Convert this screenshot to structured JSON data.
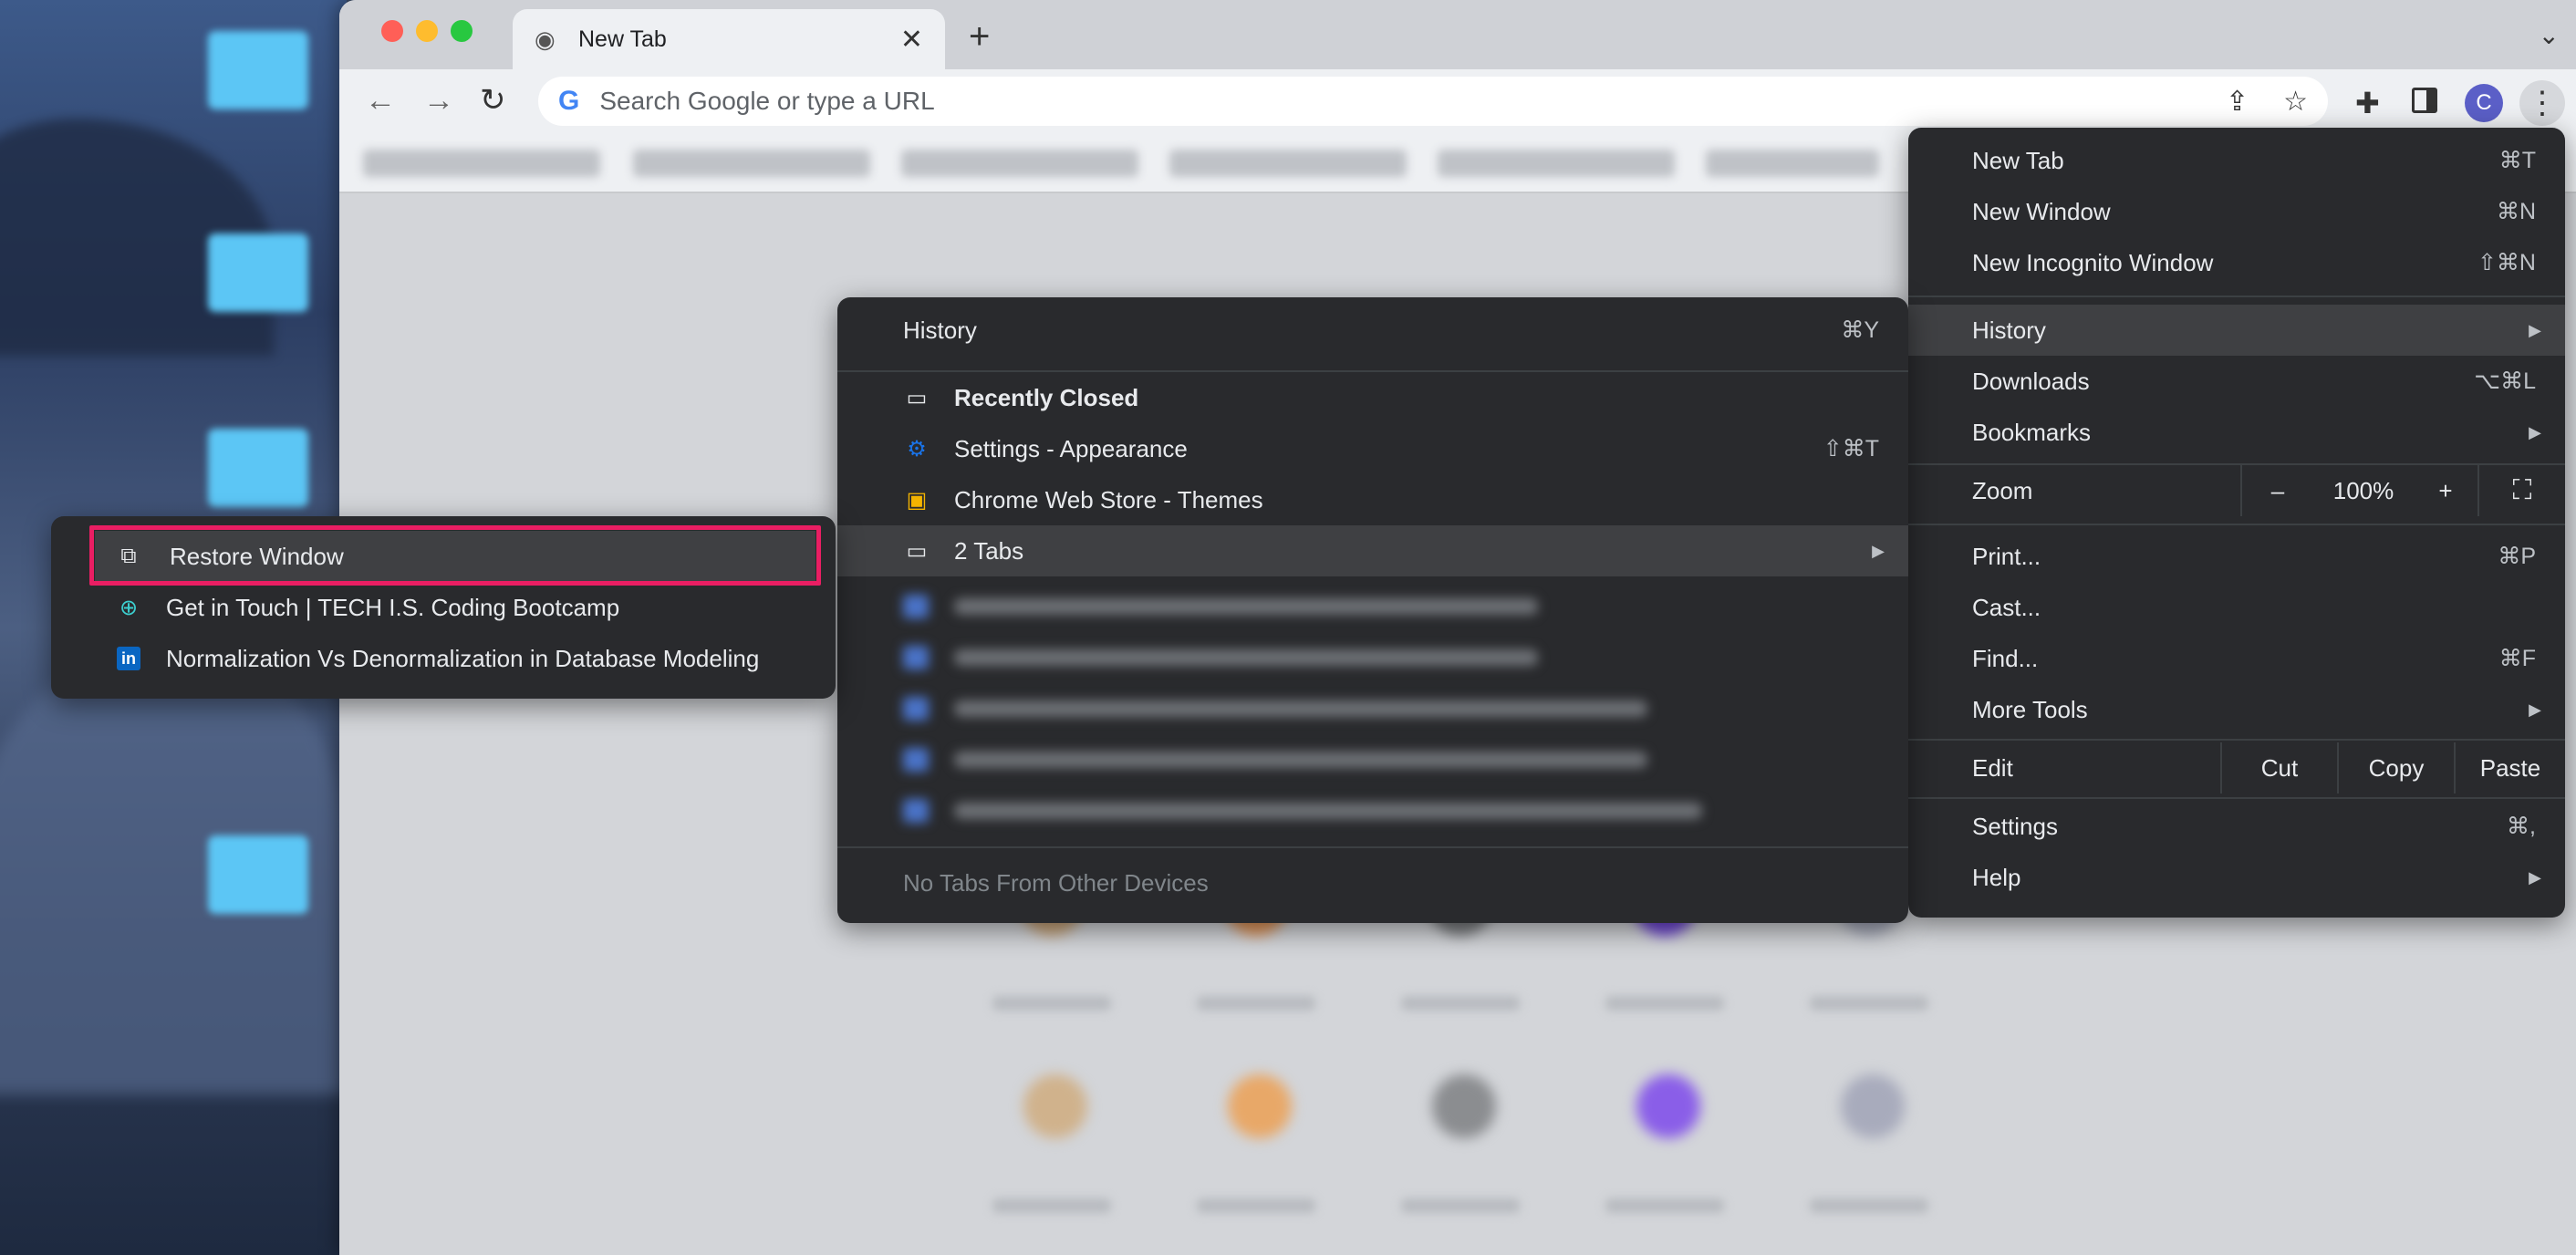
{
  "browser": {
    "tab_title": "New Tab",
    "omnibox_placeholder": "Search Google or type a URL",
    "avatar_initial": "C"
  },
  "main_menu": {
    "new_tab": {
      "label": "New Tab",
      "shortcut": "⌘T"
    },
    "new_window": {
      "label": "New Window",
      "shortcut": "⌘N"
    },
    "new_incognito": {
      "label": "New Incognito Window",
      "shortcut": "⇧⌘N"
    },
    "history": {
      "label": "History"
    },
    "downloads": {
      "label": "Downloads",
      "shortcut": "⌥⌘L"
    },
    "bookmarks": {
      "label": "Bookmarks"
    },
    "zoom": {
      "label": "Zoom",
      "minus": "–",
      "level": "100%",
      "plus": "+"
    },
    "print": {
      "label": "Print...",
      "shortcut": "⌘P"
    },
    "cast": {
      "label": "Cast..."
    },
    "find": {
      "label": "Find...",
      "shortcut": "⌘F"
    },
    "more_tools": {
      "label": "More Tools"
    },
    "edit": {
      "label": "Edit",
      "cut": "Cut",
      "copy": "Copy",
      "paste": "Paste"
    },
    "settings": {
      "label": "Settings",
      "shortcut": "⌘,"
    },
    "help": {
      "label": "Help"
    }
  },
  "history_menu": {
    "history": {
      "label": "History",
      "shortcut": "⌘Y"
    },
    "recently_closed": {
      "label": "Recently Closed"
    },
    "settings_appearance": {
      "label": "Settings - Appearance",
      "shortcut": "⇧⌘T"
    },
    "web_store": {
      "label": "Chrome Web Store - Themes"
    },
    "two_tabs": {
      "label": "2 Tabs"
    },
    "no_tabs_other": {
      "label": "No Tabs From Other Devices"
    }
  },
  "closed_menu": {
    "restore": {
      "label": "Restore Window"
    },
    "item1": {
      "label": "Get in Touch | TECH I.S. Coding Bootcamp"
    },
    "item2": {
      "label": "Normalization Vs Denormalization in Database Modeling"
    }
  },
  "colors": {
    "menu_bg": "#292a2d",
    "highlight_border": "#ea1e63",
    "menu_hover": "#3f4043"
  }
}
